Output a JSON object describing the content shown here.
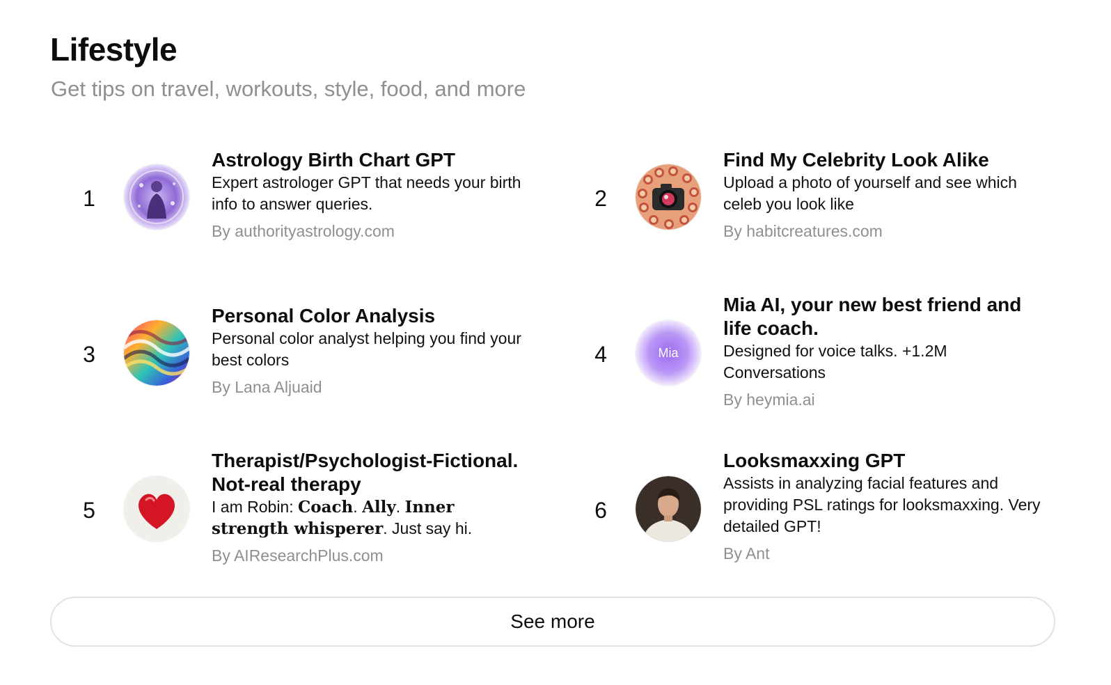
{
  "section": {
    "title": "Lifestyle",
    "subtitle": "Get tips on travel, workouts, style, food, and more"
  },
  "items": [
    {
      "rank": "1",
      "title": "Astrology Birth Chart GPT",
      "description": "Expert astrologer GPT that needs your birth info to answer queries.",
      "author": "By authorityastrology.com",
      "icon": "astrology-avatar-icon"
    },
    {
      "rank": "2",
      "title": "Find My Celebrity Look Alike",
      "description": "Upload a photo of yourself and see which celeb you look like",
      "author": "By habitcreatures.com",
      "icon": "camera-collage-avatar-icon"
    },
    {
      "rank": "3",
      "title": "Personal Color Analysis",
      "description": "Personal color analyst helping you find your best colors",
      "author": "By Lana Aljuaid",
      "icon": "color-swirl-avatar-icon"
    },
    {
      "rank": "4",
      "title": "Mia AI, your new best friend and life coach.",
      "description": "Designed for voice talks. +1.2M Conversations",
      "author": "By heymia.ai",
      "icon": "mia-avatar-icon",
      "avatar_label": "Mia"
    },
    {
      "rank": "5",
      "title": "Therapist/Psychologist-Fictional. Not-real therapy",
      "description_parts": [
        "I am Robin: ",
        "Coach",
        ". ",
        "Ally",
        ". ",
        "Inner strength whisperer",
        ". Just say hi."
      ],
      "author": "By AIResearchPlus.com",
      "icon": "heart-avatar-icon"
    },
    {
      "rank": "6",
      "title": "Looksmaxxing GPT",
      "description": "Assists in analyzing facial features and providing PSL ratings for looksmaxxing. Very detailed GPT!",
      "author": "By Ant",
      "icon": "portrait-avatar-icon"
    }
  ],
  "see_more_label": "See more"
}
